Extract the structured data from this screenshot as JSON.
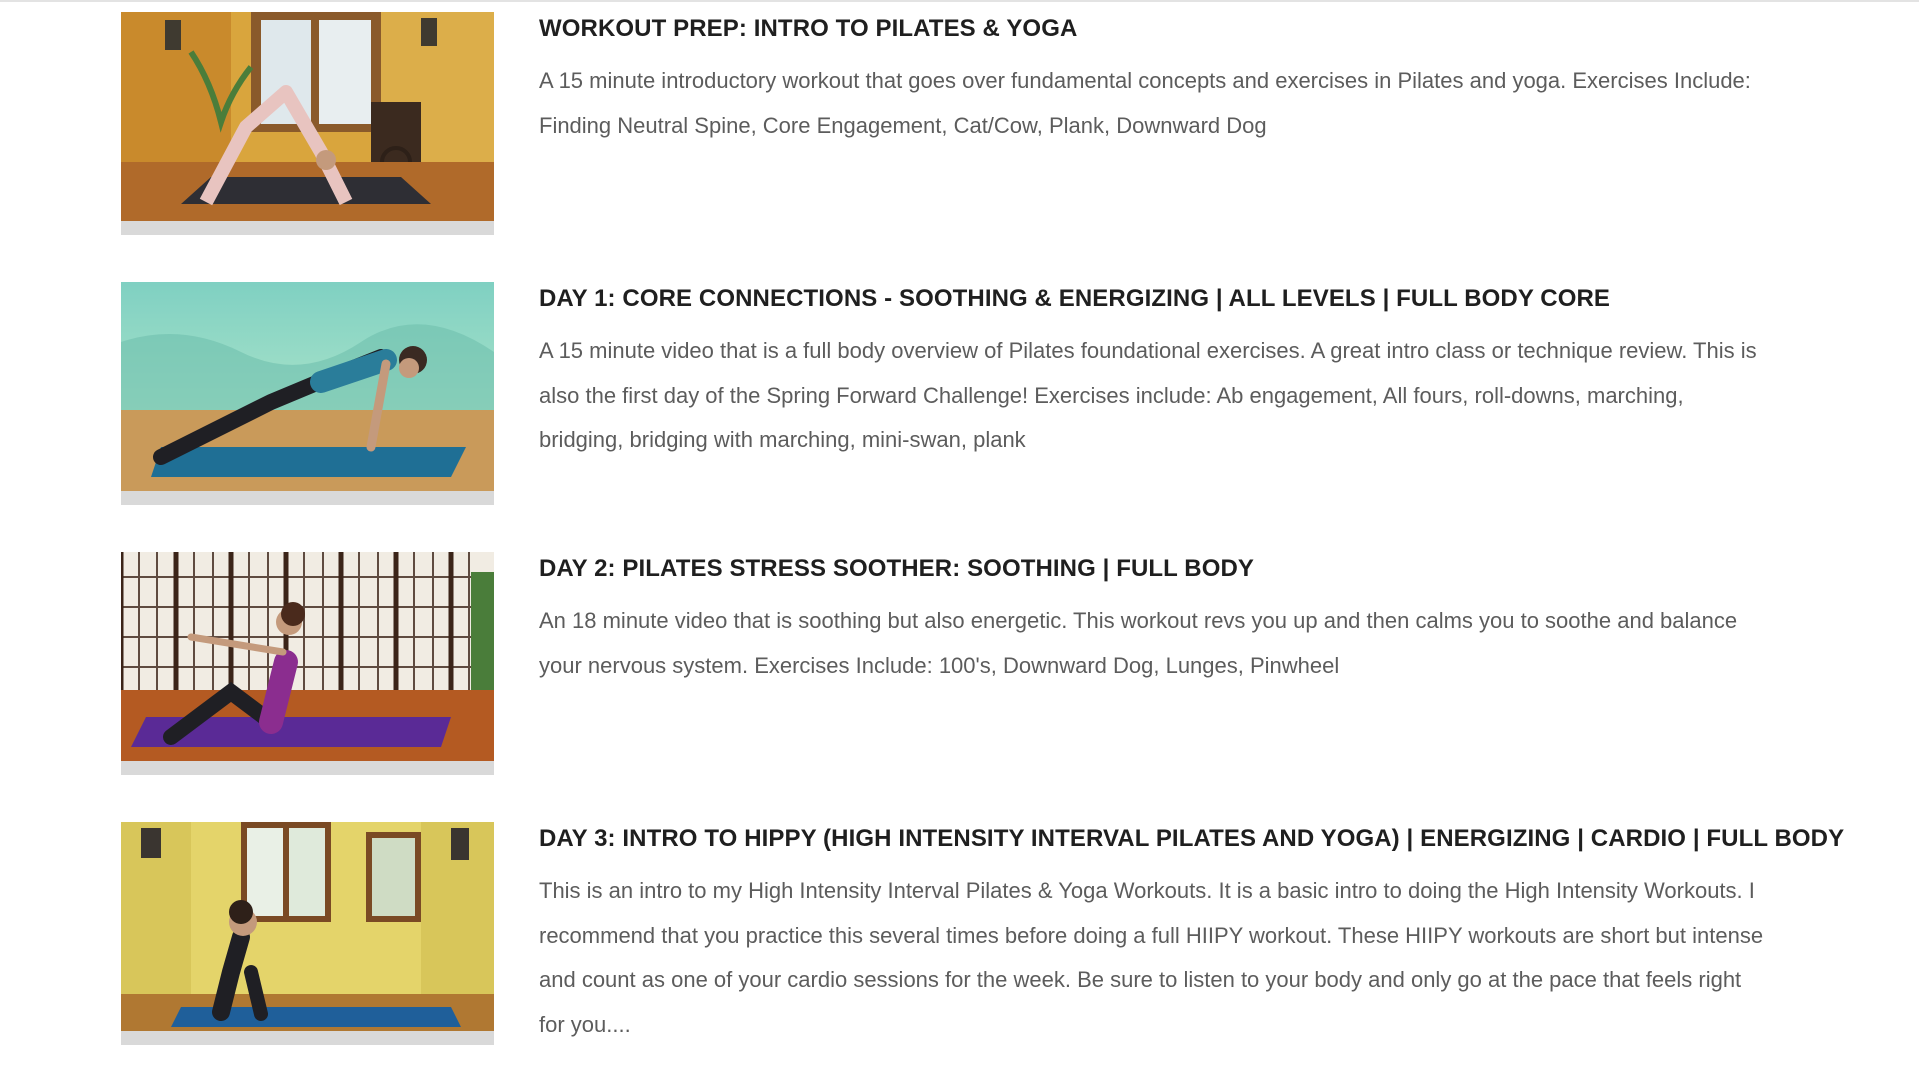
{
  "videos": [
    {
      "title": "WORKOUT PREP: INTRO TO PILATES & YOGA",
      "description": "A 15 minute introductory workout that goes over fundamental concepts and exercises in Pilates and yoga. Exercises Include:  Finding Neutral Spine, Core Engagement, Cat/Cow, Plank, Downward Dog"
    },
    {
      "title": "DAY 1: CORE CONNECTIONS - SOOTHING & ENERGIZING | ALL LEVELS | FULL BODY CORE",
      "description": "A 15 minute video that is a full body overview of Pilates foundational exercises. A great intro class or technique review. This is also the first day of the Spring Forward Challenge! Exercises include: Ab engagement, All fours, roll-downs, marching, bridging, bridging with marching, mini-swan, plank"
    },
    {
      "title": "DAY 2: PILATES STRESS SOOTHER: SOOTHING | FULL BODY",
      "description": "An 18 minute video that is soothing but also energetic. This workout revs you up and then calms you to soothe and balance your nervous system. Exercises Include: 100's, Downward Dog, Lunges, Pinwheel"
    },
    {
      "title": "DAY 3: INTRO TO HIPPY (HIGH INTENSITY INTERVAL PILATES AND YOGA) | ENERGIZING | CARDIO | FULL BODY",
      "description": "This is an intro to my High Intensity Interval Pilates & Yoga Workouts. It is a basic intro to doing the High Intensity Workouts. I recommend that you practice this several times before doing a full HIIPY workout. These HIIPY workouts are short but intense and count as one of your cardio sessions for the week. Be sure to listen to your body and only go at the pace that feels right for you...."
    }
  ]
}
